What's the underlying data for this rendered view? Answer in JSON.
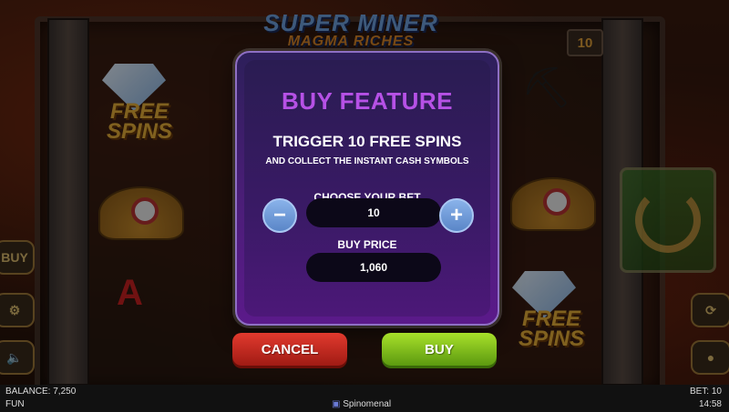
{
  "game": {
    "title_line1": "SUPER MINER",
    "title_line2": "MAGMA RICHES",
    "lines": "10",
    "free_spins_symbol": "FREE SPINS",
    "side_buy_label": "BUY"
  },
  "modal": {
    "title": "BUY FEATURE",
    "subtitle": "TRIGGER 10 FREE SPINS",
    "description": "AND COLLECT THE INSTANT CASH SYMBOLS",
    "bet_label": "CHOOSE YOUR BET",
    "bet_value": "10",
    "price_label": "BUY PRICE",
    "price_value": "1,060",
    "minus": "−",
    "plus": "+"
  },
  "actions": {
    "cancel_label": "CANCEL",
    "buy_label": "BUY"
  },
  "status": {
    "balance": "BALANCE: 7,250",
    "mode": "FUN",
    "brand": "Spinomenal",
    "bet": "BET: 10",
    "time": "14:58"
  },
  "colors": {
    "modal_title": "#b651e6",
    "cancel": "#d22e22",
    "buy": "#8cc41e",
    "plus_minus": "#6f9ad8"
  }
}
